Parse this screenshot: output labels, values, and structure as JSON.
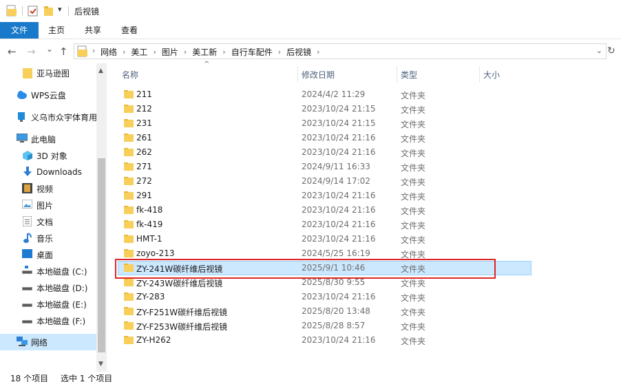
{
  "window": {
    "title": "后视镜",
    "qa_dropdown": "▾"
  },
  "ribbon": {
    "tabs": [
      {
        "label": "文件"
      },
      {
        "label": "主页"
      },
      {
        "label": "共享"
      },
      {
        "label": "查看"
      }
    ]
  },
  "nav": {
    "back": "←",
    "forward": "→",
    "recent": "⌄",
    "up": "↑",
    "refresh": "↻",
    "address_dropdown": "⌄",
    "crumb_sep": "›",
    "breadcrumbs": [
      "网络",
      "美工",
      "图片",
      "美工新",
      "自行车配件",
      "后视镜"
    ]
  },
  "navpane": {
    "items": [
      {
        "label": "亚马逊图",
        "icon": "folder-icon"
      },
      {
        "label": "WPS云盘",
        "icon": "cloud-icon"
      },
      {
        "label": "义乌市众宇体育用",
        "icon": "network-share-icon"
      },
      {
        "label": "此电脑",
        "icon": "computer-icon"
      },
      {
        "label": "3D 对象",
        "icon": "cube-icon"
      },
      {
        "label": "Downloads",
        "icon": "download-icon"
      },
      {
        "label": "视频",
        "icon": "video-icon"
      },
      {
        "label": "图片",
        "icon": "picture-icon"
      },
      {
        "label": "文档",
        "icon": "document-icon"
      },
      {
        "label": "音乐",
        "icon": "music-icon"
      },
      {
        "label": "桌面",
        "icon": "desktop-icon"
      },
      {
        "label": "本地磁盘 (C:)",
        "icon": "drive-icon"
      },
      {
        "label": "本地磁盘 (D:)",
        "icon": "drive-icon"
      },
      {
        "label": "本地磁盘 (E:)",
        "icon": "drive-icon"
      },
      {
        "label": "本地磁盘 (F:)",
        "icon": "drive-icon"
      },
      {
        "label": "网络",
        "icon": "network-icon"
      }
    ],
    "scroll_up": "▲",
    "scroll_down": "▼"
  },
  "filelist": {
    "columns": {
      "name": "名称",
      "date": "修改日期",
      "type": "类型",
      "size": "大小"
    },
    "sort_indicator": "^",
    "rows": [
      {
        "name": "211",
        "date": "2024/4/2 11:29",
        "type": "文件夹"
      },
      {
        "name": "212",
        "date": "2023/10/24 21:15",
        "type": "文件夹"
      },
      {
        "name": "231",
        "date": "2023/10/24 21:15",
        "type": "文件夹"
      },
      {
        "name": "261",
        "date": "2023/10/24 21:16",
        "type": "文件夹"
      },
      {
        "name": "262",
        "date": "2023/10/24 21:16",
        "type": "文件夹"
      },
      {
        "name": "271",
        "date": "2024/9/11 16:33",
        "type": "文件夹"
      },
      {
        "name": "272",
        "date": "2024/9/14 17:02",
        "type": "文件夹"
      },
      {
        "name": "291",
        "date": "2023/10/24 21:16",
        "type": "文件夹"
      },
      {
        "name": "fk-418",
        "date": "2023/10/24 21:16",
        "type": "文件夹"
      },
      {
        "name": "fk-419",
        "date": "2023/10/24 21:16",
        "type": "文件夹"
      },
      {
        "name": "HMT-1",
        "date": "2023/10/24 21:16",
        "type": "文件夹"
      },
      {
        "name": "zoyo-213",
        "date": "2024/5/25 16:19",
        "type": "文件夹"
      },
      {
        "name": "ZY-241W碳纤维后视镜",
        "date": "2025/9/1 10:46",
        "type": "文件夹",
        "selected": true
      },
      {
        "name": "ZY-243W碳纤维后视镜",
        "date": "2025/8/30 9:55",
        "type": "文件夹"
      },
      {
        "name": "ZY-283",
        "date": "2023/10/24 21:16",
        "type": "文件夹"
      },
      {
        "name": "ZY-F251W碳纤维后视镜",
        "date": "2025/8/20 13:48",
        "type": "文件夹"
      },
      {
        "name": "ZY-F253W碳纤维后视镜",
        "date": "2025/8/28 8:57",
        "type": "文件夹"
      },
      {
        "name": "ZY-H262",
        "date": "2023/10/24 21:16",
        "type": "文件夹"
      }
    ]
  },
  "status": {
    "count": "18 个项目",
    "selection": "选中 1 个项目"
  },
  "colors": {
    "accent": "#1979ca",
    "selection_bg": "#cce8ff",
    "highlight_box": "#e02424",
    "folder": "#f7cf5a"
  }
}
